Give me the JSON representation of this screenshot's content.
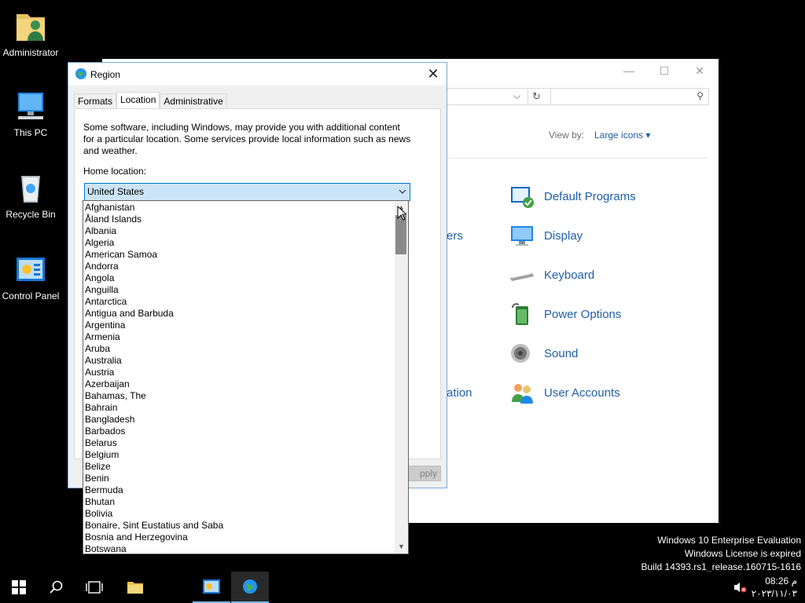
{
  "desktop": {
    "icons": [
      {
        "label": "Administrator"
      },
      {
        "label": "This PC"
      },
      {
        "label": "Recycle Bin"
      },
      {
        "label": "Control Panel"
      }
    ]
  },
  "control_panel": {
    "view_by_label": "View by:",
    "view_by_value": "Large icons ▾",
    "items": [
      {
        "label": "Default Programs"
      },
      {
        "label": "Display"
      },
      {
        "label": "Keyboard"
      },
      {
        "label": "Power Options"
      },
      {
        "label": "Sound"
      },
      {
        "label": "User Accounts"
      }
    ],
    "fragments": [
      "ers",
      "ation"
    ]
  },
  "dialog": {
    "title": "Region",
    "tabs": [
      "Formats",
      "Location",
      "Administrative"
    ],
    "active_tab": "Location",
    "description": "Some software, including Windows, may provide you with additional content for a particular location. Some services provide local information such as news and weather.",
    "home_location_label": "Home location:",
    "home_location_value": "United States",
    "apply_fragment": "pply"
  },
  "dropdown": {
    "options": [
      "Afghanistan",
      "Åland Islands",
      "Albania",
      "Algeria",
      "American Samoa",
      "Andorra",
      "Angola",
      "Anguilla",
      "Antarctica",
      "Antigua and Barbuda",
      "Argentina",
      "Armenia",
      "Aruba",
      "Australia",
      "Austria",
      "Azerbaijan",
      "Bahamas, The",
      "Bahrain",
      "Bangladesh",
      "Barbados",
      "Belarus",
      "Belgium",
      "Belize",
      "Benin",
      "Bermuda",
      "Bhutan",
      "Bolivia",
      "Bonaire, Sint Eustatius and Saba",
      "Bosnia and Herzegovina",
      "Botswana"
    ]
  },
  "watermark": {
    "line1": "Windows 10 Enterprise Evaluation",
    "line2": "Windows License is expired",
    "line3": "Build 14393.rs1_release.160715-1616"
  },
  "tray": {
    "time": "08:26 م",
    "date": "٢٠٢٣/١١/٠٣"
  },
  "colors": {
    "accent": "#0078d7",
    "link": "#1f5fa8",
    "selection": "#cce4f7"
  }
}
